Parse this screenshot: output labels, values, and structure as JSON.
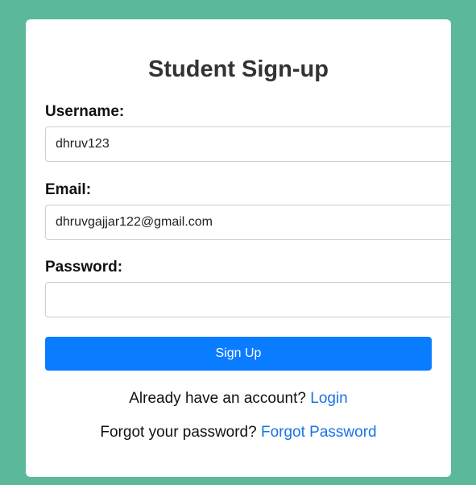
{
  "form": {
    "title": "Student Sign-up",
    "username_label": "Username:",
    "username_value": "dhruv123",
    "email_label": "Email:",
    "email_value": "dhruvgajjar122@gmail.com",
    "password_label": "Password:",
    "password_value": "",
    "submit_label": "Sign Up"
  },
  "footer": {
    "account_prompt": "Already have an account?",
    "login_link": "Login",
    "forgot_prompt": "Forgot your password?",
    "forgot_link": "Forgot Password"
  },
  "colors": {
    "background": "#5bb89a",
    "button": "#0a7cff",
    "link": "#1a73e8"
  }
}
